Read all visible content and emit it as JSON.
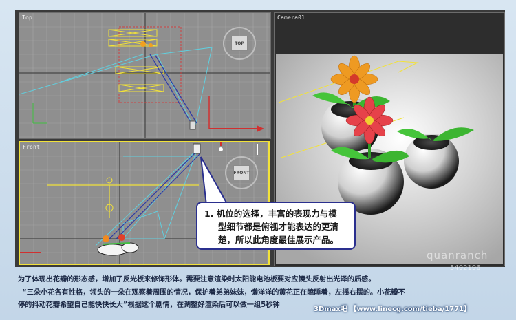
{
  "viewports": {
    "top": {
      "label": "Top",
      "cube_label": "TOP"
    },
    "front": {
      "label": "Front",
      "cube_label": "FRONT"
    },
    "camera": {
      "label": "Camera01"
    }
  },
  "callout": {
    "lines": [
      "1. 机位的选择，丰富的表现力与模",
      "型细节都是俯视才能表达的更清",
      "楚，所以此角度最佳展示产品。"
    ]
  },
  "caption": {
    "lines": [
      "为了体现出花瓣的形态感，增加了反光板来修饰形体。需要注意渲染时太阳能电池板要对应镜头反射出光泽的质感。",
      "“三朵小花各有性格，领头的一朵在观察着周围的情况，保护着弟弟妹妹，懒洋洋的黄花正在瞌睡着，左摇右摆的。小花瓣不",
      "停的抖动花瓣希望自己能快快长大”根据这个剧情，在调整好渲染后可以做一组5秒钟"
    ]
  },
  "watermarks": {
    "footer": "3Dmax吧 【www.linecg.com/tieba/1771】",
    "brand": "quanranch",
    "id": "5492196"
  },
  "colors": {
    "selection": "#f2e23a",
    "callout_border": "#2a2f8e",
    "grid": "#a6a6a6",
    "camera_bg": "#2d2d2d"
  }
}
